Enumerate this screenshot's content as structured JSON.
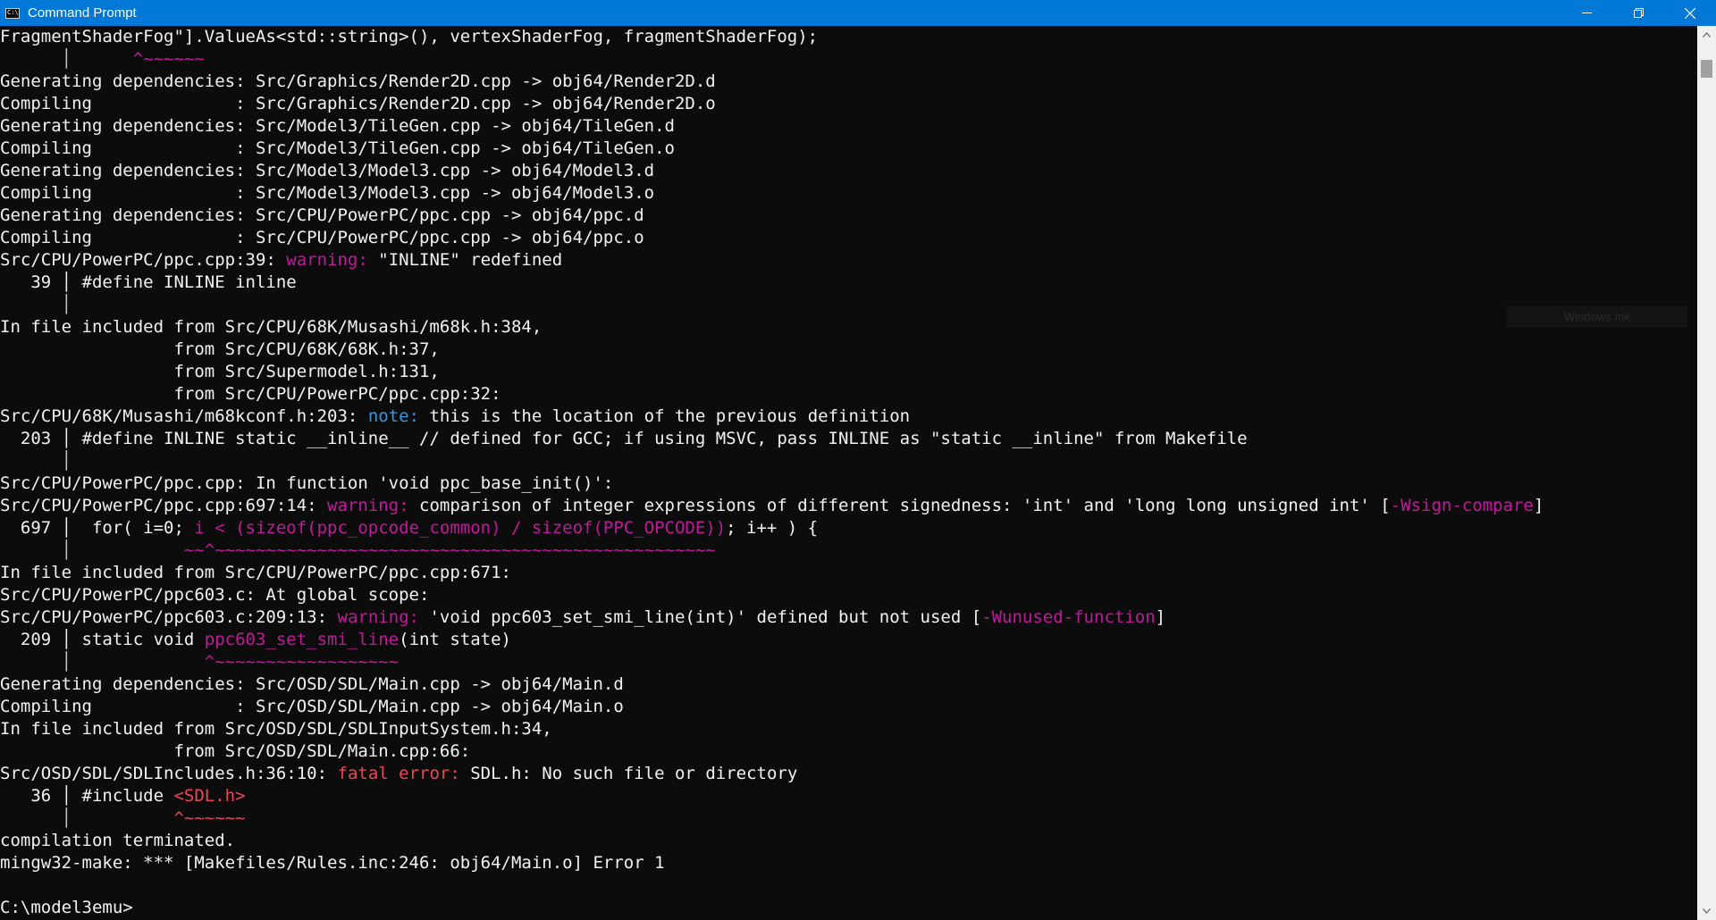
{
  "window": {
    "title": "Command Prompt",
    "icon_label": "C:\\"
  },
  "colors": {
    "titlebar": "#0078d7",
    "background": "#0c0c0c",
    "text": "#cccccc",
    "warning": "#c2189b",
    "note": "#3a96dd",
    "error": "#e74856"
  },
  "overlay": {
    "text": "Windows Ink"
  },
  "terminal": {
    "lines": [
      [
        {
          "t": "FragmentShaderFog\"].ValueAs<std::string>(), vertexShaderFog, fragmentShaderFog);",
          "c": "white"
        }
      ],
      [
        {
          "t": "      │      ",
          "c": "bar"
        },
        {
          "t": "^~~~~~~",
          "c": "magenta"
        }
      ],
      [
        {
          "t": "Generating dependencies: Src/Graphics/Render2D.cpp -> obj64/Render2D.d",
          "c": "white"
        }
      ],
      [
        {
          "t": "Compiling              : Src/Graphics/Render2D.cpp -> obj64/Render2D.o",
          "c": "white"
        }
      ],
      [
        {
          "t": "Generating dependencies: Src/Model3/TileGen.cpp -> obj64/TileGen.d",
          "c": "white"
        }
      ],
      [
        {
          "t": "Compiling              : Src/Model3/TileGen.cpp -> obj64/TileGen.o",
          "c": "white"
        }
      ],
      [
        {
          "t": "Generating dependencies: Src/Model3/Model3.cpp -> obj64/Model3.d",
          "c": "white"
        }
      ],
      [
        {
          "t": "Compiling              : Src/Model3/Model3.cpp -> obj64/Model3.o",
          "c": "white"
        }
      ],
      [
        {
          "t": "Generating dependencies: Src/CPU/PowerPC/ppc.cpp -> obj64/ppc.d",
          "c": "white"
        }
      ],
      [
        {
          "t": "Compiling              : Src/CPU/PowerPC/ppc.cpp -> obj64/ppc.o",
          "c": "white"
        }
      ],
      [
        {
          "t": "Src/CPU/PowerPC/ppc.cpp:39: ",
          "c": "white"
        },
        {
          "t": "warning: ",
          "c": "magenta"
        },
        {
          "t": "\"INLINE\" redefined",
          "c": "white"
        }
      ],
      [
        {
          "t": "   39 │ #define INLINE inline",
          "c": "white"
        }
      ],
      [
        {
          "t": "      │",
          "c": "bar"
        }
      ],
      [
        {
          "t": "In file included from Src/CPU/68K/Musashi/m68k.h:384,",
          "c": "white"
        }
      ],
      [
        {
          "t": "                 from Src/CPU/68K/68K.h:37,",
          "c": "white"
        }
      ],
      [
        {
          "t": "                 from Src/Supermodel.h:131,",
          "c": "white"
        }
      ],
      [
        {
          "t": "                 from Src/CPU/PowerPC/ppc.cpp:32:",
          "c": "white"
        }
      ],
      [
        {
          "t": "Src/CPU/68K/Musashi/m68kconf.h:203: ",
          "c": "white"
        },
        {
          "t": "note: ",
          "c": "cyan"
        },
        {
          "t": "this is the location of the previous definition",
          "c": "white"
        }
      ],
      [
        {
          "t": "  203 │ #define INLINE static __inline__ // defined for GCC; if using MSVC, pass INLINE as \"static __inline\" from Makefile",
          "c": "white"
        }
      ],
      [
        {
          "t": "      │",
          "c": "bar"
        }
      ],
      [
        {
          "t": "Src/CPU/PowerPC/ppc.cpp: In function 'void ppc_base_init()':",
          "c": "white"
        }
      ],
      [
        {
          "t": "Src/CPU/PowerPC/ppc.cpp:697:14: ",
          "c": "white"
        },
        {
          "t": "warning: ",
          "c": "magenta"
        },
        {
          "t": "comparison of integer expressions of different signedness: 'int' and 'long long unsigned int' [",
          "c": "white"
        },
        {
          "t": "-Wsign-compare",
          "c": "magenta"
        },
        {
          "t": "]",
          "c": "white"
        }
      ],
      [
        {
          "t": "  697 │  for( i=0; ",
          "c": "white"
        },
        {
          "t": "i < (sizeof(ppc_opcode_common) / sizeof(PPC_OPCODE))",
          "c": "magenta"
        },
        {
          "t": "; i++ ) {",
          "c": "white"
        }
      ],
      [
        {
          "t": "      │           ",
          "c": "bar"
        },
        {
          "t": "~~^~~~~~~~~~~~~~~~~~~~~~~~~~~~~~~~~~~~~~~~~~~~~~~~~~",
          "c": "magenta"
        }
      ],
      [
        {
          "t": "In file included from Src/CPU/PowerPC/ppc.cpp:671:",
          "c": "white"
        }
      ],
      [
        {
          "t": "Src/CPU/PowerPC/ppc603.c: At global scope:",
          "c": "white"
        }
      ],
      [
        {
          "t": "Src/CPU/PowerPC/ppc603.c:209:13: ",
          "c": "white"
        },
        {
          "t": "warning: ",
          "c": "magenta"
        },
        {
          "t": "'void ppc603_set_smi_line(int)' defined but not used [",
          "c": "white"
        },
        {
          "t": "-Wunused-function",
          "c": "magenta"
        },
        {
          "t": "]",
          "c": "white"
        }
      ],
      [
        {
          "t": "  209 │ static void ",
          "c": "white"
        },
        {
          "t": "ppc603_set_smi_line",
          "c": "magenta"
        },
        {
          "t": "(int state)",
          "c": "white"
        }
      ],
      [
        {
          "t": "      │             ",
          "c": "bar"
        },
        {
          "t": "^~~~~~~~~~~~~~~~~~~",
          "c": "magenta"
        }
      ],
      [
        {
          "t": "Generating dependencies: Src/OSD/SDL/Main.cpp -> obj64/Main.d",
          "c": "white"
        }
      ],
      [
        {
          "t": "Compiling              : Src/OSD/SDL/Main.cpp -> obj64/Main.o",
          "c": "white"
        }
      ],
      [
        {
          "t": "In file included from Src/OSD/SDL/SDLInputSystem.h:34,",
          "c": "white"
        }
      ],
      [
        {
          "t": "                 from Src/OSD/SDL/Main.cpp:66:",
          "c": "white"
        }
      ],
      [
        {
          "t": "Src/OSD/SDL/SDLIncludes.h:36:10: ",
          "c": "white"
        },
        {
          "t": "fatal error: ",
          "c": "red"
        },
        {
          "t": "SDL.h: No such file or directory",
          "c": "white"
        }
      ],
      [
        {
          "t": "   36 │ #include ",
          "c": "white"
        },
        {
          "t": "<SDL.h>",
          "c": "red"
        }
      ],
      [
        {
          "t": "      │          ",
          "c": "bar"
        },
        {
          "t": "^~~~~~~",
          "c": "red"
        }
      ],
      [
        {
          "t": "compilation terminated.",
          "c": "white"
        }
      ],
      [
        {
          "t": "mingw32-make: *** [Makefiles/Rules.inc:246: obj64/Main.o] Error 1",
          "c": "white"
        }
      ],
      [
        {
          "t": "",
          "c": "white"
        }
      ],
      [
        {
          "t": "C:\\model3emu>",
          "c": "white"
        }
      ]
    ]
  }
}
